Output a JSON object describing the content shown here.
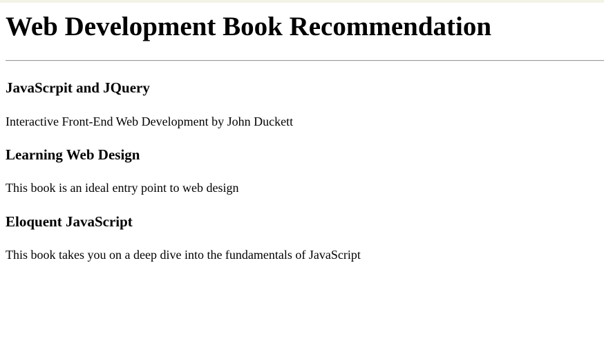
{
  "page": {
    "title": "Web Development Book Recommendation"
  },
  "books": [
    {
      "title": "JavaScrpit and JQuery",
      "description": "Interactive Front-End Web Development by John Duckett"
    },
    {
      "title": "Learning Web Design",
      "description": "This book is an ideal entry point to web design"
    },
    {
      "title": "Eloquent JavaScript",
      "description": "This book takes you on a deep dive into the fundamentals of JavaScript"
    }
  ]
}
